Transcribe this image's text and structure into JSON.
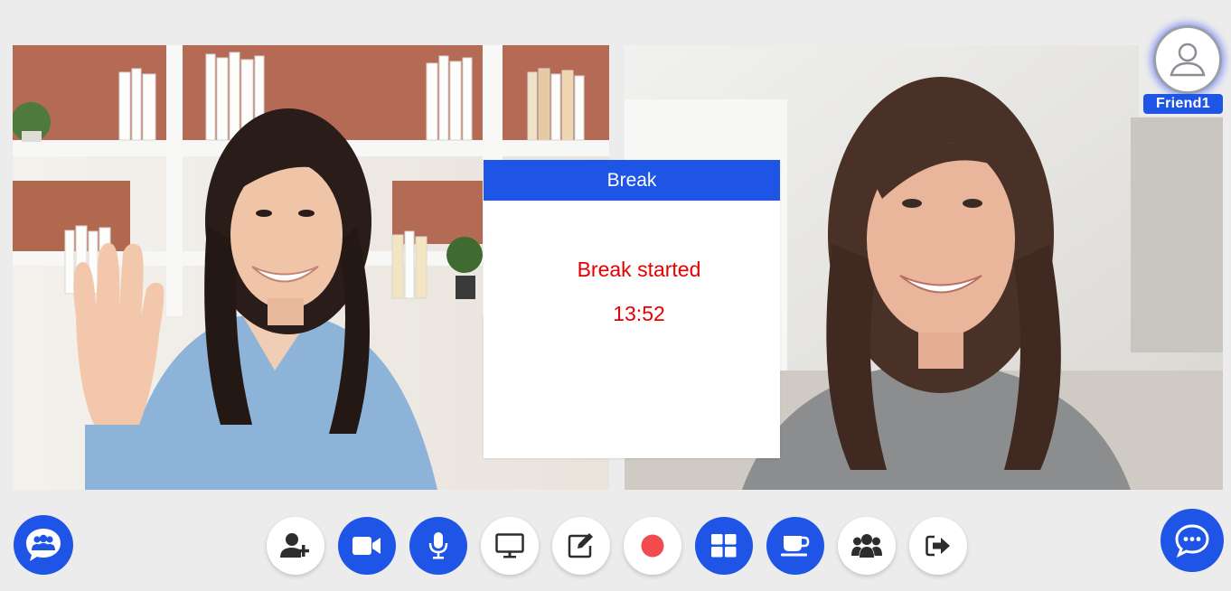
{
  "videos": [
    {
      "participant": "left-participant"
    },
    {
      "participant": "right-participant"
    }
  ],
  "break_modal": {
    "title": "Break",
    "message": "Break started",
    "timer": "13:52"
  },
  "friend": {
    "name": "Friend1"
  },
  "toolbar": {
    "buttons": [
      {
        "icon": "add-user-icon"
      },
      {
        "icon": "video-camera-icon"
      },
      {
        "icon": "microphone-icon"
      },
      {
        "icon": "screen-share-icon"
      },
      {
        "icon": "whiteboard-edit-icon"
      },
      {
        "icon": "record-icon"
      },
      {
        "icon": "grid-layout-icon"
      },
      {
        "icon": "coffee-break-icon"
      },
      {
        "icon": "participants-icon"
      },
      {
        "icon": "leave-icon"
      }
    ]
  },
  "colors": {
    "accent": "#1f55e6",
    "background": "#ececec",
    "alert_text": "#e60000",
    "record": "#f24b4f"
  }
}
